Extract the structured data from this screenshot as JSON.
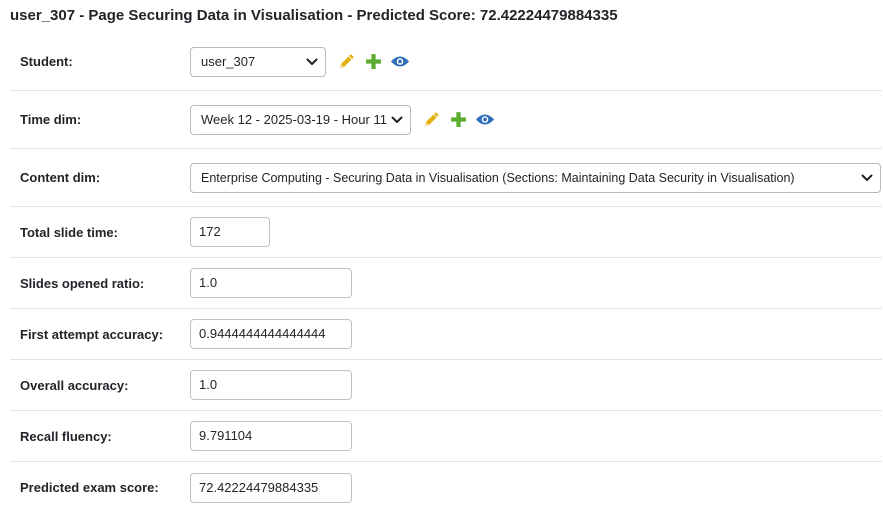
{
  "page": {
    "title": "user_307 - Page Securing Data in Visualisation - Predicted Score: 72.42224479884335"
  },
  "colors": {
    "edit_icon": "#e0b10f",
    "add_icon": "#5cad2f",
    "view_icon": "#2f6fba",
    "divider": "#e4e4e4"
  },
  "icons": {
    "edit": "pencil-icon",
    "add": "plus-icon",
    "view": "eye-icon",
    "dropdown": "chevron-down-icon"
  },
  "fields": {
    "student": {
      "label": "Student:",
      "value": "user_307"
    },
    "time_dim": {
      "label": "Time dim:",
      "value": "Week 12 - 2025-03-19 - Hour 11"
    },
    "content_dim": {
      "label": "Content dim:",
      "value": "Enterprise Computing - Securing Data in Visualisation (Sections: Maintaining Data Security in Visualisation)"
    },
    "total_slide_time": {
      "label": "Total slide time:",
      "value": "172"
    },
    "slides_opened_ratio": {
      "label": "Slides opened ratio:",
      "value": "1.0"
    },
    "first_attempt_accuracy": {
      "label": "First attempt accuracy:",
      "value": "0.9444444444444444"
    },
    "overall_accuracy": {
      "label": "Overall accuracy:",
      "value": "1.0"
    },
    "recall_fluency": {
      "label": "Recall fluency:",
      "value": "9.791104"
    },
    "predicted_exam_score": {
      "label": "Predicted exam score:",
      "value": "72.42224479884335"
    }
  }
}
